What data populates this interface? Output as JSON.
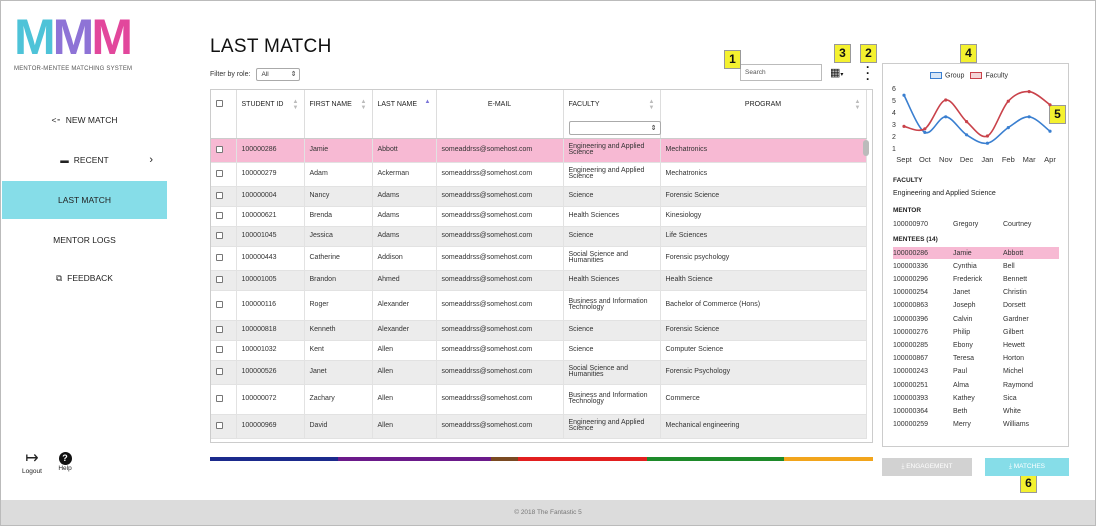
{
  "logo": {
    "letters": [
      "M",
      "M",
      "M"
    ],
    "subtitle": "MENTOR-MENTEE MATCHING SYSTEM"
  },
  "sidebar": {
    "items": [
      {
        "label": "NEW MATCH",
        "icon": "share-nodes-icon"
      },
      {
        "label": "RECENT",
        "icon": "archive-box-icon"
      },
      {
        "label": "LAST MATCH"
      },
      {
        "label": "MENTOR LOGS"
      },
      {
        "label": "FEEDBACK",
        "icon": "feedback-copy-icon"
      }
    ],
    "logout_label": "Logout",
    "help_label": "Help"
  },
  "main": {
    "title": "LAST MATCH",
    "filter_label": "Filter by role:",
    "filter_value": "All",
    "search_placeholder": "Search"
  },
  "callouts": [
    "1",
    "2",
    "3",
    "4",
    "5",
    "6"
  ],
  "table": {
    "columns": [
      "STUDENT ID",
      "FIRST NAME",
      "LAST NAME",
      "E-MAIL",
      "FACULTY",
      "PROGRAM"
    ],
    "rows": [
      [
        "100000286",
        "Jamie",
        "Abbott",
        "someaddrss@somehost.com",
        "Engineering and Applied Science",
        "Mechatronics"
      ],
      [
        "100000279",
        "Adam",
        "Ackerman",
        "someaddrss@somehost.com",
        "Engineering and Applied Science",
        "Mechatronics"
      ],
      [
        "100000004",
        "Nancy",
        "Adams",
        "someaddrss@somehost.com",
        "Science",
        "Forensic Science"
      ],
      [
        "100000621",
        "Brenda",
        "Adams",
        "someaddrss@somehost.com",
        "Health Sciences",
        "Kinesiology"
      ],
      [
        "100001045",
        "Jessica",
        "Adams",
        "someaddrss@somehost.com",
        "Science",
        "Life Sciences"
      ],
      [
        "100000443",
        "Catherine",
        "Addison",
        "someaddrss@somehost.com",
        "Social Science and Humanities",
        "Forensic psychology"
      ],
      [
        "100001005",
        "Brandon",
        "Ahmed",
        "someaddrss@somehost.com",
        "Health Sciences",
        "Health Science"
      ],
      [
        "100000116",
        "Roger",
        "Alexander",
        "someaddrss@somehost.com",
        "Business and Information Technology",
        "Bachelor of Commerce (Hons)"
      ],
      [
        "100000818",
        "Kenneth",
        "Alexander",
        "someaddrss@somehost.com",
        "Science",
        "Forensic Science"
      ],
      [
        "100001032",
        "Kent",
        "Allen",
        "someaddrss@somehost.com",
        "Science",
        "Computer Science"
      ],
      [
        "100000526",
        "Janet",
        "Allen",
        "someaddrss@somehost.com",
        "Social Science and Humanities",
        "Forensic Psychology"
      ],
      [
        "100000072",
        "Zachary",
        "Allen",
        "someaddrss@somehost.com",
        "Business and Information Technology",
        "Commerce"
      ],
      [
        "100000969",
        "David",
        "Allen",
        "someaddrss@somehost.com",
        "Engineering and Applied Science",
        "Mechanical engineering"
      ]
    ]
  },
  "colorbar_colors": [
    "#1b2a8c",
    "#6b1a8a",
    "#7a4a22",
    "#e21f1f",
    "#1e8a2a",
    "#f2a51c"
  ],
  "chart_data": {
    "type": "line",
    "categories": [
      "Sept",
      "Oct",
      "Nov",
      "Dec",
      "Jan",
      "Feb",
      "Mar",
      "Apr"
    ],
    "series": [
      {
        "name": "Group",
        "color": "#3a7fd0",
        "values": [
          5.4,
          2.3,
          3.6,
          2.1,
          1.4,
          2.7,
          3.6,
          2.4
        ]
      },
      {
        "name": "Faculty",
        "color": "#c9424a",
        "values": [
          2.8,
          2.6,
          5.0,
          3.2,
          2.0,
          4.9,
          5.7,
          4.6
        ]
      }
    ],
    "yticks": [
      1,
      2,
      3,
      4,
      5,
      6
    ],
    "ylim": [
      1,
      6
    ],
    "legend": "top"
  },
  "details": {
    "faculty_label": "FACULTY",
    "faculty_value": "Engineering and Applied Science",
    "mentor_label": "MENTOR",
    "mentor": [
      "100000970",
      "Gregory",
      "Courtney"
    ],
    "mentees_label": "MENTEES (14)",
    "mentees": [
      [
        "100000286",
        "Jamie",
        "Abbott"
      ],
      [
        "100000336",
        "Cynthia",
        "Bell"
      ],
      [
        "100000296",
        "Frederick",
        "Bennett"
      ],
      [
        "100000254",
        "Janet",
        "Christin"
      ],
      [
        "100000863",
        "Joseph",
        "Dorsett"
      ],
      [
        "100000396",
        "Calvin",
        "Gardner"
      ],
      [
        "100000276",
        "Philip",
        "Gilbert"
      ],
      [
        "100000285",
        "Ebony",
        "Hewett"
      ],
      [
        "100000867",
        "Teresa",
        "Horton"
      ],
      [
        "100000243",
        "Paul",
        "Michel"
      ],
      [
        "100000251",
        "Alma",
        "Raymond"
      ],
      [
        "100000393",
        "Kathey",
        "Sica"
      ],
      [
        "100000364",
        "Beth",
        "White"
      ],
      [
        "100000259",
        "Merry",
        "Williams"
      ]
    ]
  },
  "buttons": {
    "engagement": "ENGAGEMENT",
    "matches": "MATCHES"
  },
  "footer": "© 2018 The Fantastic 5"
}
